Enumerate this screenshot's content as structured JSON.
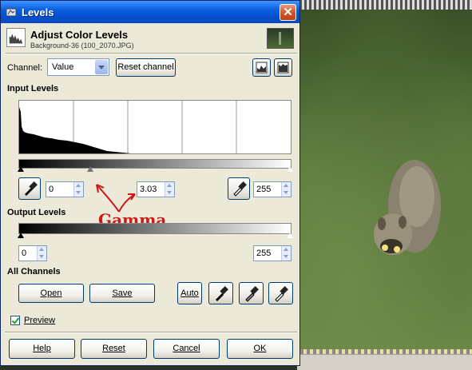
{
  "window": {
    "title": "Levels",
    "close_glyph": "✕"
  },
  "header": {
    "title": "Adjust Color Levels",
    "subtitle": "Background-36 (100_2070.JPG)"
  },
  "channel": {
    "label": "Channel:",
    "value": "Value",
    "reset_label": "Reset channel"
  },
  "input_levels": {
    "heading": "Input Levels",
    "black_point": "0",
    "gamma": "3.03",
    "white_point": "255"
  },
  "output_levels": {
    "heading": "Output Levels",
    "low": "0",
    "high": "255"
  },
  "all_channels": {
    "heading": "All Channels",
    "open_label": "Open",
    "save_label": "Save",
    "auto_label": "Auto"
  },
  "preview": {
    "label": "Preview",
    "checked": true
  },
  "buttons": {
    "help": "Help",
    "reset": "Reset",
    "cancel": "Cancel",
    "ok": "OK"
  },
  "annotation": {
    "text": "Gamma",
    "color": "#d01818"
  },
  "colors": {
    "titlebar": "#0550d0",
    "dialog_bg": "#ece9d8",
    "close": "#d4562c"
  },
  "icons": [
    "levels-icon",
    "linear-histogram-icon",
    "log-histogram-icon",
    "eyedropper-icon"
  ]
}
